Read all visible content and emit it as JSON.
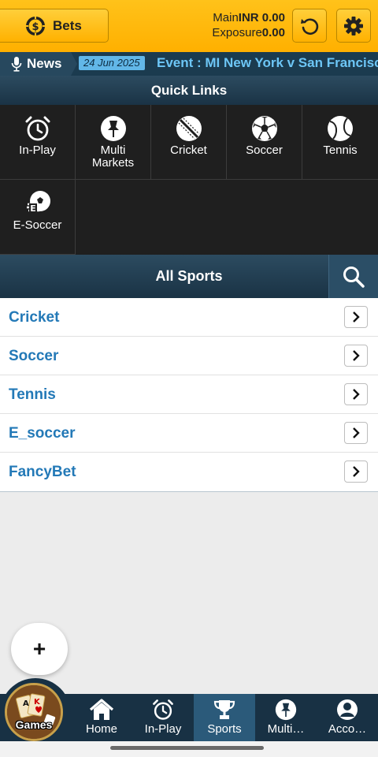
{
  "header": {
    "bets_label": "Bets",
    "main_label": "Main",
    "main_value": "INR 0.00",
    "exposure_label": "Exposure",
    "exposure_value": "0.00"
  },
  "news": {
    "label": "News",
    "date": "24 Jun 2025",
    "text": "Event : MI New York v San Francisc"
  },
  "quick_links": {
    "title": "Quick Links",
    "items": [
      {
        "label": "In-Play",
        "icon": "alarm-clock-icon"
      },
      {
        "label": "Multi Markets",
        "icon": "pushpin-icon"
      },
      {
        "label": "Cricket",
        "icon": "cricket-ball-icon"
      },
      {
        "label": "Soccer",
        "icon": "soccer-ball-icon"
      },
      {
        "label": "Tennis",
        "icon": "tennis-ball-icon"
      },
      {
        "label": "E-Soccer",
        "icon": "e-soccer-icon"
      }
    ]
  },
  "all_sports": {
    "title": "All Sports",
    "items": [
      "Cricket",
      "Soccer",
      "Tennis",
      "E_soccer",
      "FancyBet"
    ]
  },
  "fab": {
    "label": "+"
  },
  "games": {
    "label": "Games"
  },
  "bottom_nav": {
    "active": "Sports",
    "items": [
      {
        "label": "Home",
        "icon": "home-icon"
      },
      {
        "label": "In-Play",
        "icon": "alarm-clock-icon"
      },
      {
        "label": "Sports",
        "icon": "trophy-icon"
      },
      {
        "label": "Multi…",
        "icon": "pushpin-icon"
      },
      {
        "label": "Acco…",
        "icon": "user-icon"
      }
    ]
  },
  "colors": {
    "brand_yellow": "#ffb80c",
    "navy": "#1a3345",
    "link_blue": "#2379b7",
    "news_blue": "#6dc6f6"
  }
}
